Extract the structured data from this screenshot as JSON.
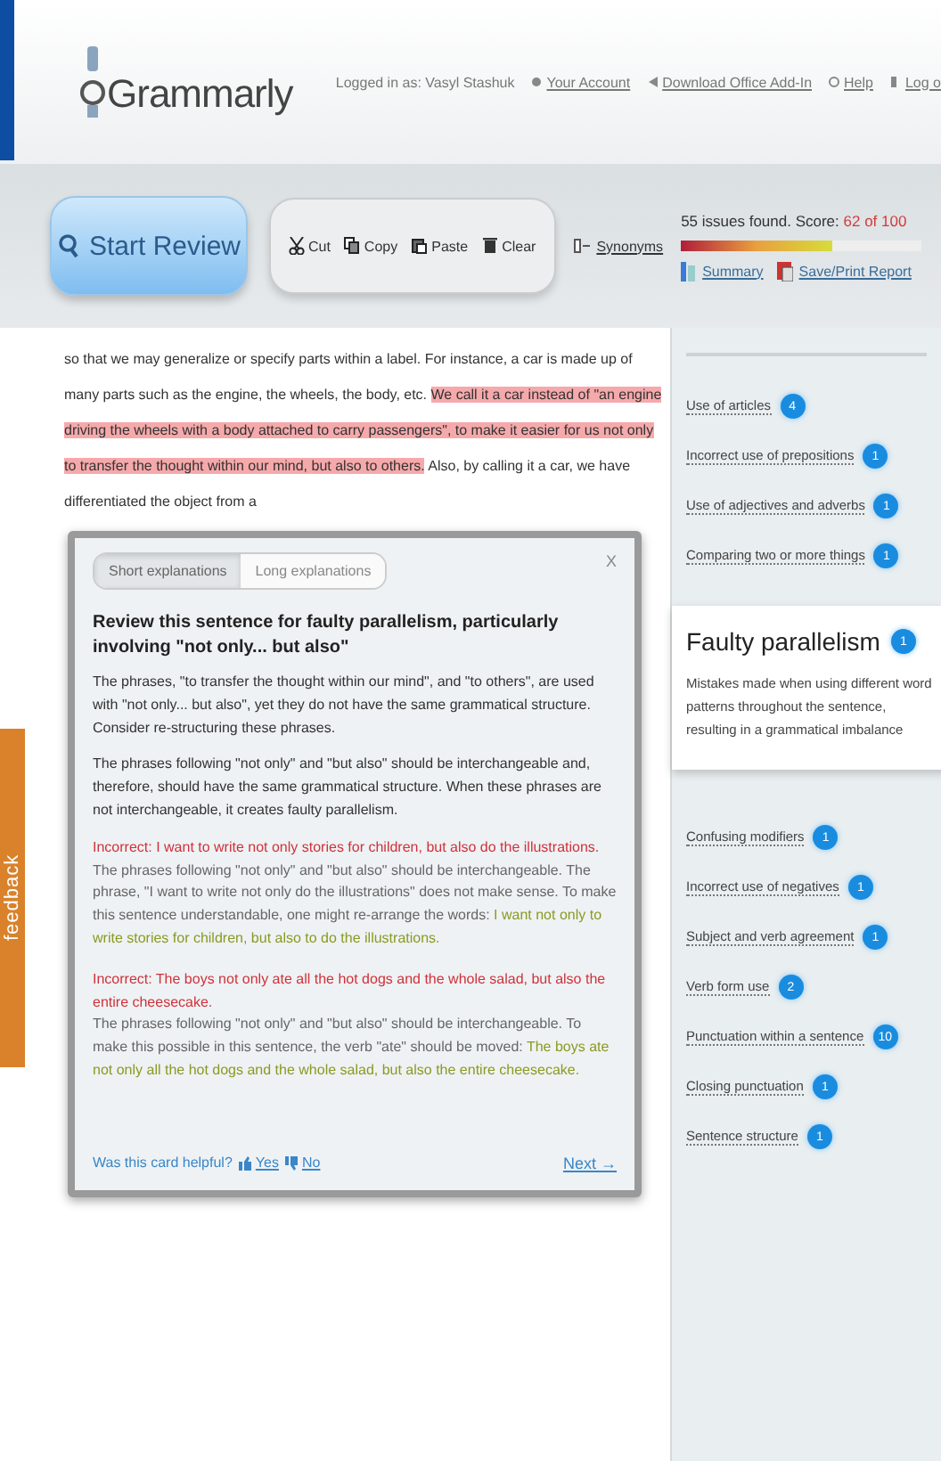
{
  "header": {
    "logo": "Grammarly",
    "logged_in": "Logged in as: Vasyl Stashuk",
    "links": [
      "Your Account",
      "Download Office Add-In",
      "Help",
      "Log o"
    ]
  },
  "toolbar": {
    "start_button": "Start Review",
    "edit_buttons": [
      "Cut",
      "Copy",
      "Paste",
      "Clear"
    ],
    "synonyms": "Synonyms",
    "synonyms_on": false,
    "summary_text": "55 issues found. Score: ",
    "score": "62 of 100",
    "score_bar": {
      "level": 0.63
    },
    "report_links": [
      "Summary",
      "Save/Print Report"
    ]
  },
  "editor": {
    "text_before": "so that we may generalize or specify parts within a label. For instance, a car is made up of many parts such as the engine, the wheels, the body, etc. ",
    "highlight": "We call it a car instead of \"an engine driving the wheels with a body attached to carry passengers\", to make it easier for us not only to transfer the thought within our mind, but also to others.",
    "text_after": " Also, by calling it a car, we have differentiated the object from a"
  },
  "feedback_tab": "feedback",
  "card": {
    "tabs": [
      {
        "label": "Short explanations",
        "selected": true
      },
      {
        "label": "Long explanations",
        "selected": false
      }
    ],
    "close": "X",
    "title": "Review this sentence for faulty parallelism, particularly involving \"not only... but also\"",
    "paragraphs": [
      "The phrases, \"to transfer the thought within our mind\", and \"to others\", are used with \"not only... but also\", yet they do not have the same grammatical structure. Consider re-structuring these phrases.",
      "The phrases following \"not only\" and \"but also\" should be interchangeable and, therefore, should have the same grammatical structure. When these phrases are not interchangeable, it creates faulty parallelism."
    ],
    "examples": [
      {
        "incorrect": "Incorrect: I want to write not only stories for children, but also do the illustrations.",
        "explanation": "The phrases following \"not only\" and \"but also\" should be interchangeable. The phrase, \"I want to write not only do the illustrations\" does not make sense. To make this sentence understandable, one might re-arrange the words: ",
        "correct": "I want not only to write stories for children, but also to do the illustrations."
      },
      {
        "incorrect": "Incorrect: The boys not only ate all the hot dogs and the whole salad, but also the entire cheesecake.",
        "explanation": "The phrases following \"not only\" and \"but also\" should be interchangeable. To make this possible in this sentence, the verb \"ate\" should be moved: ",
        "correct": "The boys ate not only all the hot dogs and the whole salad, but also the entire cheesecake."
      }
    ],
    "helpful": "Was this card helpful?",
    "yes": "Yes",
    "no": "No",
    "next": "Next →"
  },
  "categories": [
    {
      "label": "Use of articles",
      "count": "4",
      "selected": false
    },
    {
      "label": "Incorrect use of prepositions",
      "count": "1",
      "selected": false
    },
    {
      "label": "Use of adjectives and adverbs",
      "count": "1",
      "selected": false
    },
    {
      "label": "Comparing two or more things",
      "count": "1",
      "selected": false
    },
    {
      "label": "Faulty parallelism",
      "count": "1",
      "selected": true,
      "description": "Mistakes made when using different word patterns throughout the sentence, resulting in a grammatical imbalance"
    },
    {
      "label": "Confusing modifiers",
      "count": "1",
      "selected": false
    },
    {
      "label": "Incorrect use of negatives",
      "count": "1",
      "selected": false
    },
    {
      "label": "Subject and verb agreement",
      "count": "1",
      "selected": false
    },
    {
      "label": "Verb form use",
      "count": "2",
      "selected": false
    },
    {
      "label": "Punctuation within a sentence",
      "count": "10",
      "selected": false
    },
    {
      "label": "Closing punctuation",
      "count": "1",
      "selected": false
    },
    {
      "label": "Sentence structure",
      "count": "1",
      "selected": false
    }
  ]
}
